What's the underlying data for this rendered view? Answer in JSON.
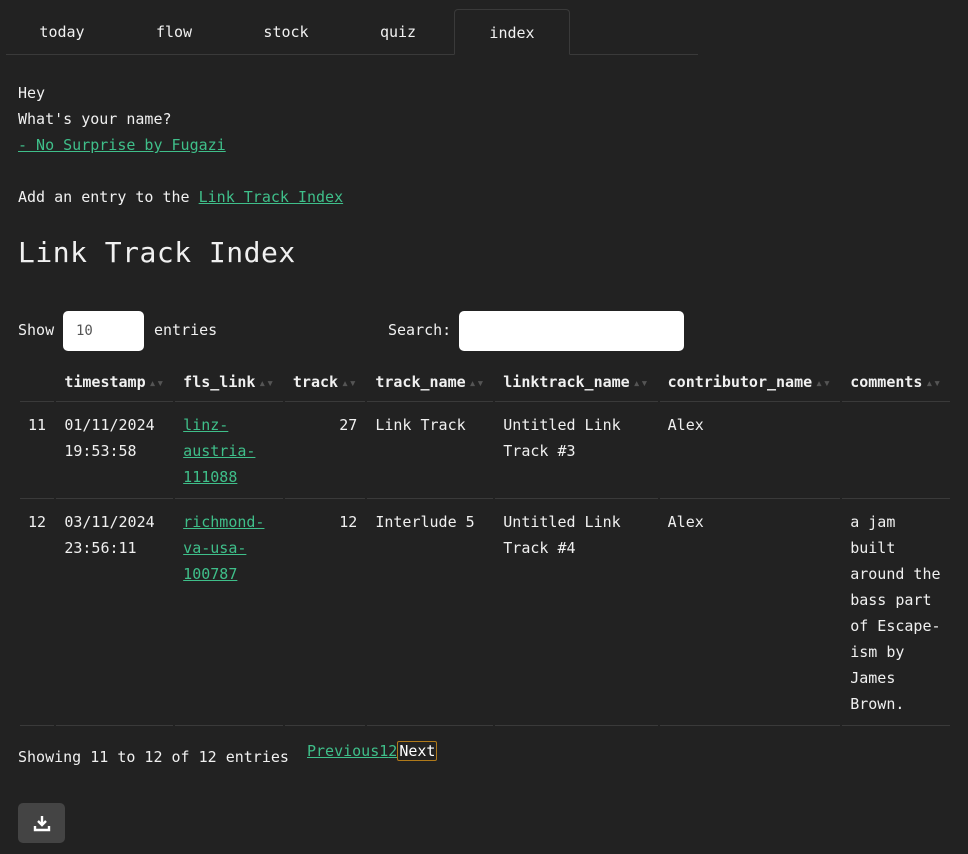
{
  "tabs": [
    {
      "label": "today"
    },
    {
      "label": "flow"
    },
    {
      "label": "stock"
    },
    {
      "label": "quiz"
    },
    {
      "label": "index"
    }
  ],
  "intro": {
    "hey": "Hey",
    "question": "What's your name?",
    "song_link": "- No Surprise by Fugazi",
    "add_prefix": "Add an entry to the ",
    "add_link": "Link Track Index"
  },
  "page_title": "Link Track Index",
  "controls": {
    "show_label": "Show",
    "entries_value": "10",
    "entries_label": "entries",
    "search_label": "Search:",
    "search_value": ""
  },
  "table": {
    "columns": [
      "",
      "timestamp",
      "fls_link",
      "track",
      "track_name",
      "linktrack_name",
      "contributor_name",
      "comments"
    ],
    "rows": [
      {
        "id": "11",
        "timestamp_date": "01/11/2024",
        "timestamp_time": "19:53:58",
        "fls_link": [
          "linz-",
          "austria-",
          "111088"
        ],
        "track": "27",
        "track_name": "Link Track",
        "linktrack_name": [
          "Untitled Link",
          "Track #3"
        ],
        "contributor_name": "Alex",
        "comments": []
      },
      {
        "id": "12",
        "timestamp_date": "03/11/2024",
        "timestamp_time": "23:56:11",
        "fls_link": [
          "richmond-",
          "va-usa-",
          "100787"
        ],
        "track": "12",
        "track_name": "Interlude 5",
        "linktrack_name": [
          "Untitled Link",
          "Track #4"
        ],
        "contributor_name": "Alex",
        "comments": [
          "a jam",
          "built",
          "around the",
          "bass part",
          "of Escape-",
          "ism by",
          "James",
          "Brown."
        ]
      }
    ]
  },
  "footer": {
    "info": "Showing 11 to 12 of 12 entries",
    "previous": "Previous",
    "page1": "1",
    "page2": "2",
    "next": "Next"
  },
  "icons": {
    "download": "download-icon",
    "sort": "sort-icon"
  },
  "colors": {
    "background": "#222222",
    "link": "#3fbf8a",
    "current_page_border": "#b07a1a"
  }
}
